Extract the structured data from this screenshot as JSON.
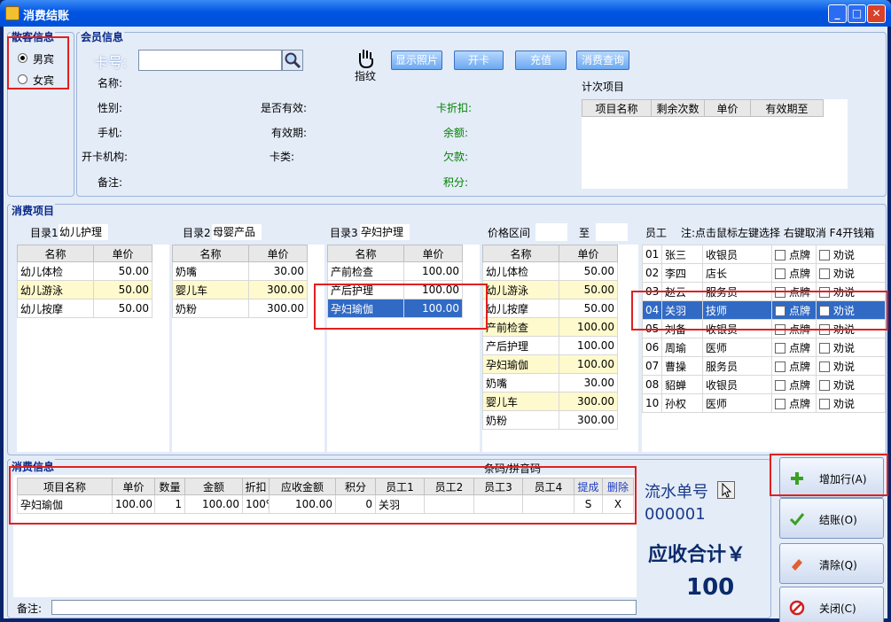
{
  "window": {
    "title": "消费结账"
  },
  "guest": {
    "title": "散客信息",
    "options": [
      "男宾",
      "女宾"
    ]
  },
  "member": {
    "title": "会员信息",
    "card_label": "卡号:",
    "fingerprint": "指纹",
    "buttons": [
      "显示照片",
      "开卡",
      "充值",
      "消费查询"
    ],
    "fields_left": [
      "名称:",
      "性别:",
      "手机:",
      "开卡机构:",
      "备注:"
    ],
    "fields_mid": [
      "是否有效:",
      "有效期:",
      "卡类:"
    ],
    "fields_right": [
      "卡折扣:",
      "余额:",
      "欠款:",
      "积分:"
    ],
    "count_title": "计次项目",
    "count_headers": [
      "项目名称",
      "剩余次数",
      "单价",
      "有效期至"
    ]
  },
  "consume": {
    "title": "消费项目",
    "dir1": {
      "label": "目录1",
      "value": "幼儿护理"
    },
    "dir2": {
      "label": "目录2",
      "value": "母婴产品"
    },
    "dir3": {
      "label": "目录3",
      "value": "孕妇护理"
    },
    "price_range": {
      "label": "价格区间",
      "to": "至"
    },
    "staff_label": "员工",
    "staff_note": "注:点击鼠标左键选择 右键取消 F4开钱箱",
    "headers": [
      "名称",
      "单价"
    ],
    "list1": [
      [
        "幼儿体检",
        "50.00"
      ],
      [
        "幼儿游泳",
        "50.00"
      ],
      [
        "幼儿按摩",
        "50.00"
      ]
    ],
    "list2": [
      [
        "奶嘴",
        "30.00"
      ],
      [
        "婴儿车",
        "300.00"
      ],
      [
        "奶粉",
        "300.00"
      ]
    ],
    "list3": [
      [
        "产前检查",
        "100.00"
      ],
      [
        "产后护理",
        "100.00"
      ],
      [
        "孕妇瑜伽",
        "100.00"
      ]
    ],
    "list4": [
      [
        "幼儿体检",
        "50.00"
      ],
      [
        "幼儿游泳",
        "50.00"
      ],
      [
        "幼儿按摩",
        "50.00"
      ],
      [
        "产前检查",
        "100.00"
      ],
      [
        "产后护理",
        "100.00"
      ],
      [
        "孕妇瑜伽",
        "100.00"
      ],
      [
        "奶嘴",
        "30.00"
      ],
      [
        "婴儿车",
        "300.00"
      ],
      [
        "奶粉",
        "300.00"
      ]
    ],
    "staff": [
      [
        "01",
        "张三",
        "收银员"
      ],
      [
        "02",
        "李四",
        "店长"
      ],
      [
        "03",
        "赵云",
        "服务员"
      ],
      [
        "04",
        "关羽",
        "技师"
      ],
      [
        "05",
        "刘备",
        "收银员"
      ],
      [
        "06",
        "周瑜",
        "医师"
      ],
      [
        "07",
        "曹操",
        "服务员"
      ],
      [
        "08",
        "貂蝉",
        "收银员"
      ],
      [
        "10",
        "孙权",
        "医师"
      ]
    ],
    "staff_flags": [
      "点牌",
      "劝说"
    ]
  },
  "bill": {
    "title": "消费信息",
    "barcode_label": "条码/拼音码",
    "headers": [
      "项目名称",
      "单价",
      "数量",
      "金额",
      "折扣",
      "应收金额",
      "积分",
      "员工1",
      "员工2",
      "员工3",
      "员工4",
      "提成",
      "删除"
    ],
    "rows": [
      [
        "孕妇瑜伽",
        "100.00",
        "1",
        "100.00",
        "100%",
        "100.00",
        "0",
        "关羽",
        "",
        "",
        "",
        "S",
        "X"
      ]
    ],
    "remark_label": "备注:"
  },
  "summary": {
    "serial_label": "流水单号",
    "serial_value": "000001",
    "total_label": "应收合计￥",
    "total_value": "100"
  },
  "actions": {
    "add_row": "增加行(A)",
    "checkout": "结账(O)",
    "clear": "清除(Q)",
    "close": "关闭(C)"
  }
}
